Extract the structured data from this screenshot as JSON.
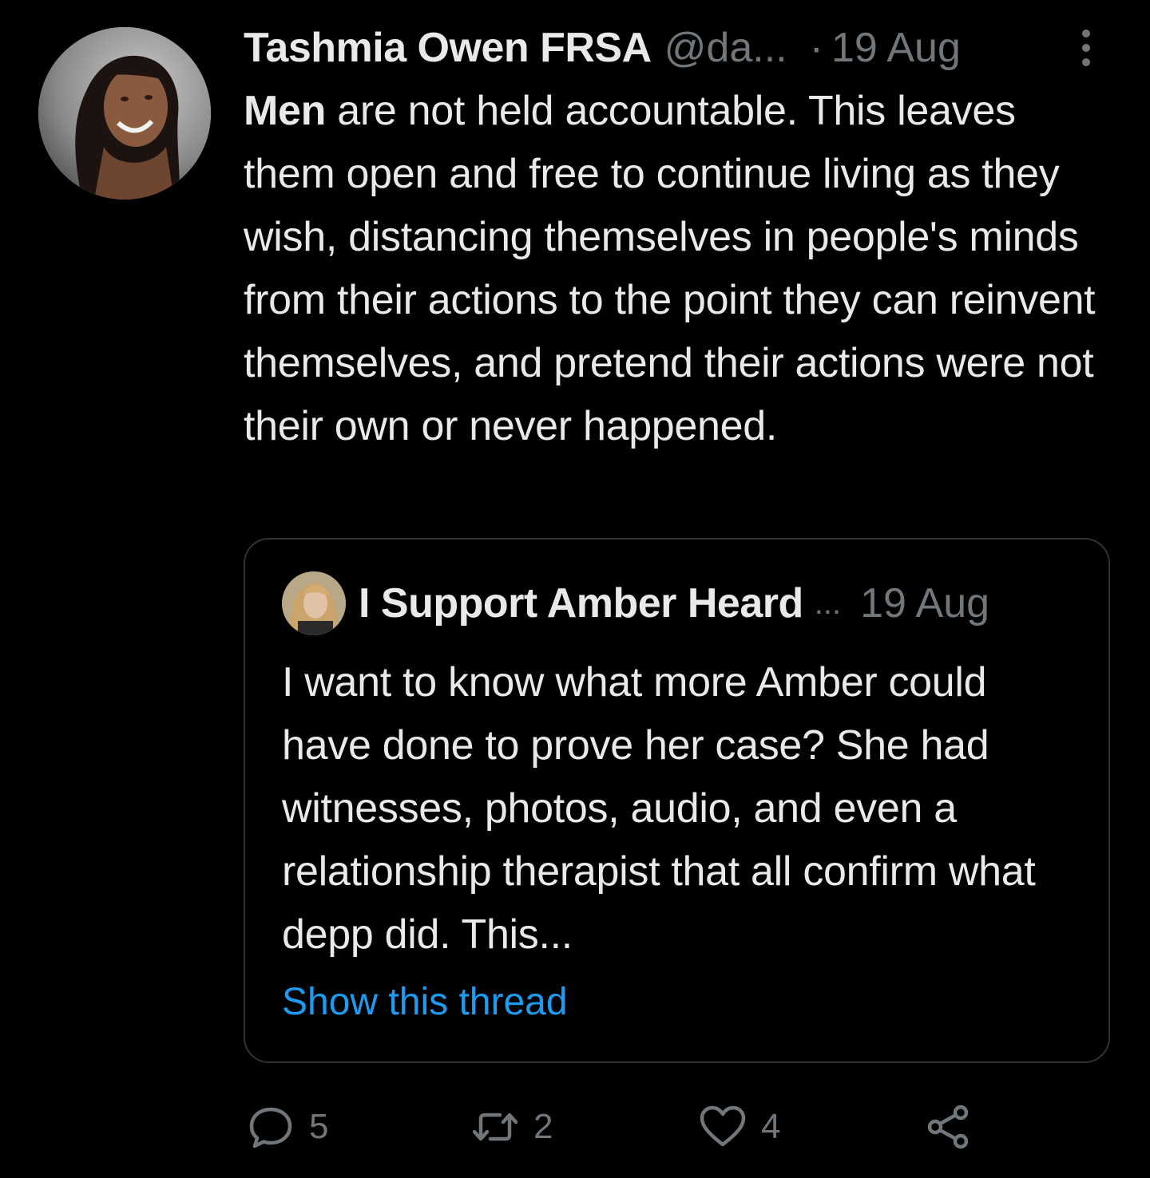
{
  "tweet": {
    "author": {
      "display_name": "Tashmia Owen FRSA",
      "handle": "@da...",
      "date_separator": "·",
      "date": "19 Aug"
    },
    "text_bold": "Men",
    "text_rest": " are not held accountable. This leaves them open and free to continue living as they wish, distancing themselves in people's minds from their actions to the point they can reinvent themselves, and pretend their actions were not their own or never happened."
  },
  "quote": {
    "display_name": "I Support Amber Heard",
    "handle": "...",
    "date": "19 Aug",
    "text": "I want to know what more Amber could have done to prove her case? She had witnesses, photos, audio, and even a relationship therapist that all confirm what depp did. This...",
    "show_thread": "Show this thread"
  },
  "actions": {
    "replies": "5",
    "retweets": "2",
    "likes": "4"
  },
  "icons": {
    "more": "more-vertical-icon",
    "reply": "reply-bubble-icon",
    "retweet": "retweet-icon",
    "like": "heart-icon",
    "share": "share-icon"
  },
  "colors": {
    "background": "#000000",
    "text": "#e7e9ea",
    "secondary_text": "#71767b",
    "link": "#1d9bf0",
    "border": "#2f3336"
  }
}
